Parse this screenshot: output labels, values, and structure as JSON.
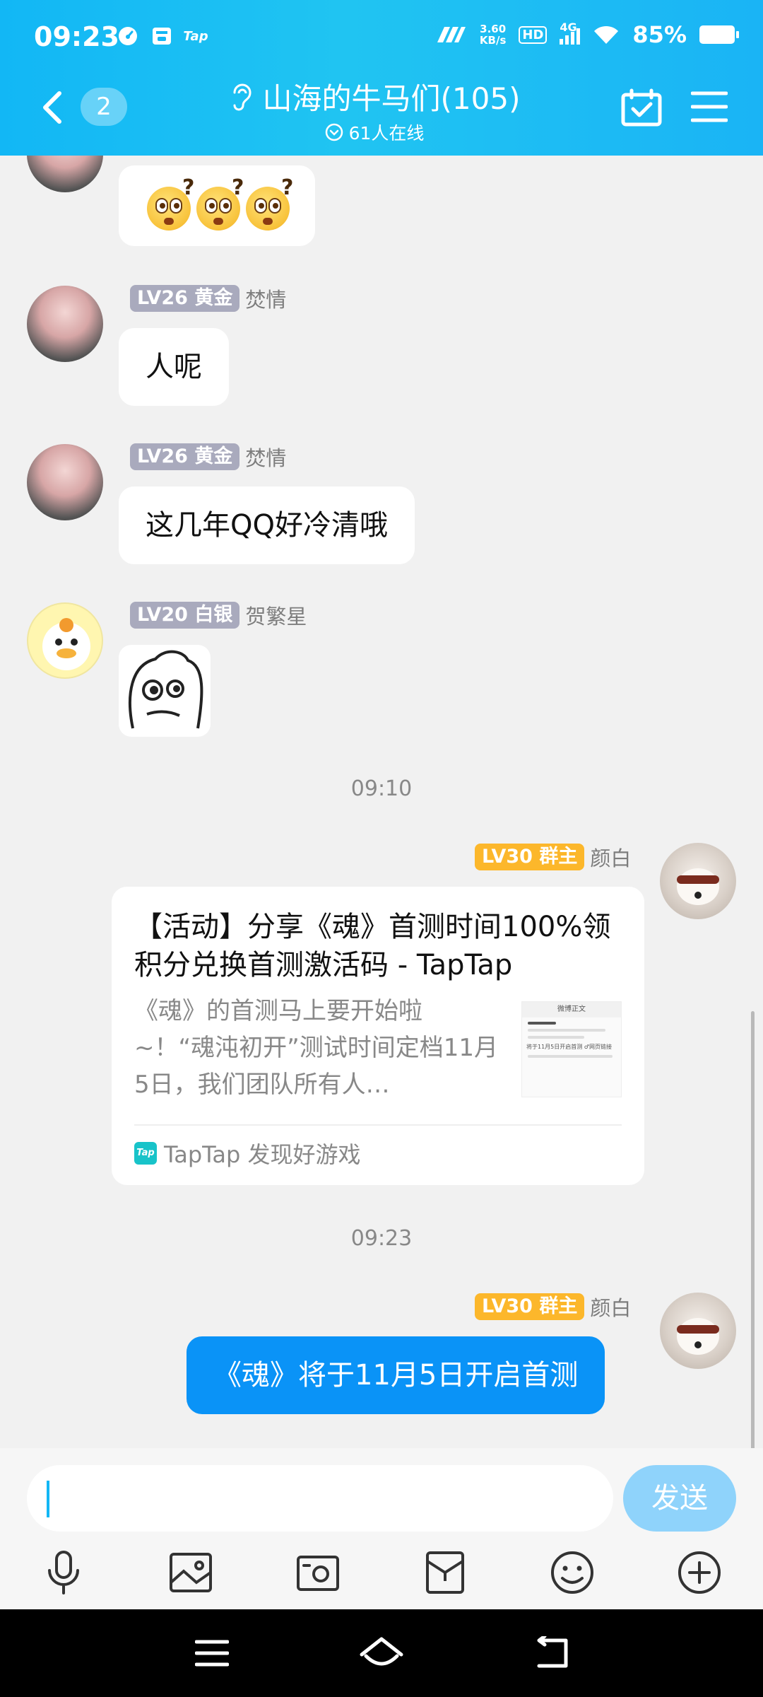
{
  "status_bar": {
    "time": "09:23",
    "left_icons": [
      "speedometer-icon",
      "wallet-icon",
      "taptap-icon"
    ],
    "tap_label": "Tap",
    "net_speed_value": "3.60",
    "net_speed_unit": "KB/s",
    "hd_label": "HD",
    "network": "4G",
    "battery_pct": "85%"
  },
  "header": {
    "unread_count": "2",
    "title": "山海的牛马们(105)",
    "online_text": "61人在线",
    "accent": "#12b7f5"
  },
  "messages": [
    {
      "kind": "emoji",
      "avatar": "pink",
      "emoji_count": 3
    },
    {
      "kind": "text",
      "level": "LV26",
      "rank": "黄金",
      "nickname": "焚情",
      "text": "人呢"
    },
    {
      "kind": "text",
      "level": "LV26",
      "rank": "黄金",
      "nickname": "焚情",
      "text": "这几年QQ好冷清哦"
    },
    {
      "kind": "sticker",
      "level": "LV20",
      "rank": "白银",
      "nickname": "贺繁星"
    }
  ],
  "timestamps": [
    "09:10",
    "09:23"
  ],
  "owner": {
    "level": "LV30",
    "rank": "群主",
    "nickname": "颜白"
  },
  "link_card": {
    "title": "【活动】分享《魂》首测时间100%领积分兑换首测激活码 - TapTap",
    "desc": "《魂》的首测马上要开始啦~！“魂沌初开”测试时间定档11月5日，我们团队所有人…",
    "thumb_header": "微博正文",
    "thumb_link": "将于11月5日开启首测 ♂网页链接",
    "source": "TapTap 发现好游戏",
    "tap_logo": "Tap"
  },
  "self_message": "《魂》将于11月5日开启首测",
  "input": {
    "value": "",
    "send_label": "发送"
  },
  "toolbar": [
    "microphone-icon",
    "image-icon",
    "camera-icon",
    "red-packet-icon",
    "smiley-icon",
    "plus-icon"
  ],
  "sysnav": [
    "menu-icon",
    "home-icon",
    "back-icon"
  ],
  "colors": {
    "level_gray": "#a9aabd",
    "owner_gold": "#fcb72b",
    "self_bubble": "#0a93f7",
    "send_button": "#8fd3fb"
  }
}
